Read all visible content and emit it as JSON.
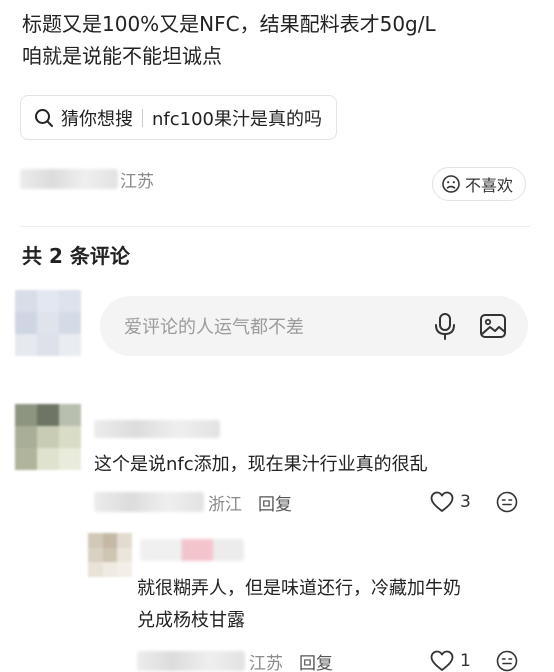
{
  "post": {
    "line1": "标题又是100%又是NFC，结果配料表才50g/L",
    "line2": "咱就是说能不能坦诚点"
  },
  "search": {
    "hint": "猜你想搜",
    "query": "nfc100果汁是真的吗",
    "icon": "search-icon"
  },
  "post_meta": {
    "location": "江苏"
  },
  "dislike": {
    "label": "不喜欢",
    "icon": "sad-face-icon"
  },
  "comments_header": {
    "title": "共 2 条评论"
  },
  "comment_box": {
    "placeholder": "爱评论的人运气都不差",
    "icons": [
      "microphone-icon",
      "image-icon"
    ]
  },
  "comments": [
    {
      "text": "这个是说nfc添加，现在果汁行业真的很乱",
      "location": "浙江",
      "reply_label": "回复",
      "likes": "3",
      "replies": [
        {
          "text_line1": "就很糊弄人，但是味道还行，冷藏加牛奶",
          "text_line2": "兑成杨枝甘露",
          "location": "江苏",
          "reply_label": "回复",
          "likes": "1"
        }
      ]
    }
  ],
  "colors": {
    "text": "#222222",
    "muted": "#8a8a8a",
    "input_bg": "#f4f4f4",
    "border": "#e3e3e3"
  }
}
